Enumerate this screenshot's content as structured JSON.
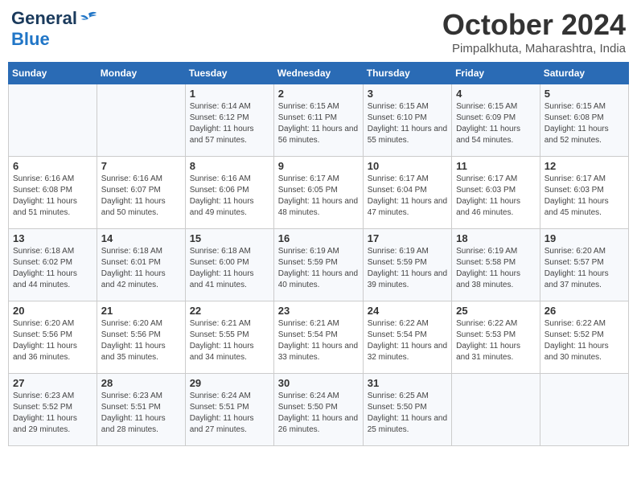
{
  "header": {
    "logo_line1": "General",
    "logo_line2": "Blue",
    "month": "October 2024",
    "location": "Pimpalkhuta, Maharashtra, India"
  },
  "weekdays": [
    "Sunday",
    "Monday",
    "Tuesday",
    "Wednesday",
    "Thursday",
    "Friday",
    "Saturday"
  ],
  "weeks": [
    [
      {
        "day": "",
        "sunrise": "",
        "sunset": "",
        "daylight": ""
      },
      {
        "day": "",
        "sunrise": "",
        "sunset": "",
        "daylight": ""
      },
      {
        "day": "1",
        "sunrise": "Sunrise: 6:14 AM",
        "sunset": "Sunset: 6:12 PM",
        "daylight": "Daylight: 11 hours and 57 minutes."
      },
      {
        "day": "2",
        "sunrise": "Sunrise: 6:15 AM",
        "sunset": "Sunset: 6:11 PM",
        "daylight": "Daylight: 11 hours and 56 minutes."
      },
      {
        "day": "3",
        "sunrise": "Sunrise: 6:15 AM",
        "sunset": "Sunset: 6:10 PM",
        "daylight": "Daylight: 11 hours and 55 minutes."
      },
      {
        "day": "4",
        "sunrise": "Sunrise: 6:15 AM",
        "sunset": "Sunset: 6:09 PM",
        "daylight": "Daylight: 11 hours and 54 minutes."
      },
      {
        "day": "5",
        "sunrise": "Sunrise: 6:15 AM",
        "sunset": "Sunset: 6:08 PM",
        "daylight": "Daylight: 11 hours and 52 minutes."
      }
    ],
    [
      {
        "day": "6",
        "sunrise": "Sunrise: 6:16 AM",
        "sunset": "Sunset: 6:08 PM",
        "daylight": "Daylight: 11 hours and 51 minutes."
      },
      {
        "day": "7",
        "sunrise": "Sunrise: 6:16 AM",
        "sunset": "Sunset: 6:07 PM",
        "daylight": "Daylight: 11 hours and 50 minutes."
      },
      {
        "day": "8",
        "sunrise": "Sunrise: 6:16 AM",
        "sunset": "Sunset: 6:06 PM",
        "daylight": "Daylight: 11 hours and 49 minutes."
      },
      {
        "day": "9",
        "sunrise": "Sunrise: 6:17 AM",
        "sunset": "Sunset: 6:05 PM",
        "daylight": "Daylight: 11 hours and 48 minutes."
      },
      {
        "day": "10",
        "sunrise": "Sunrise: 6:17 AM",
        "sunset": "Sunset: 6:04 PM",
        "daylight": "Daylight: 11 hours and 47 minutes."
      },
      {
        "day": "11",
        "sunrise": "Sunrise: 6:17 AM",
        "sunset": "Sunset: 6:03 PM",
        "daylight": "Daylight: 11 hours and 46 minutes."
      },
      {
        "day": "12",
        "sunrise": "Sunrise: 6:17 AM",
        "sunset": "Sunset: 6:03 PM",
        "daylight": "Daylight: 11 hours and 45 minutes."
      }
    ],
    [
      {
        "day": "13",
        "sunrise": "Sunrise: 6:18 AM",
        "sunset": "Sunset: 6:02 PM",
        "daylight": "Daylight: 11 hours and 44 minutes."
      },
      {
        "day": "14",
        "sunrise": "Sunrise: 6:18 AM",
        "sunset": "Sunset: 6:01 PM",
        "daylight": "Daylight: 11 hours and 42 minutes."
      },
      {
        "day": "15",
        "sunrise": "Sunrise: 6:18 AM",
        "sunset": "Sunset: 6:00 PM",
        "daylight": "Daylight: 11 hours and 41 minutes."
      },
      {
        "day": "16",
        "sunrise": "Sunrise: 6:19 AM",
        "sunset": "Sunset: 5:59 PM",
        "daylight": "Daylight: 11 hours and 40 minutes."
      },
      {
        "day": "17",
        "sunrise": "Sunrise: 6:19 AM",
        "sunset": "Sunset: 5:59 PM",
        "daylight": "Daylight: 11 hours and 39 minutes."
      },
      {
        "day": "18",
        "sunrise": "Sunrise: 6:19 AM",
        "sunset": "Sunset: 5:58 PM",
        "daylight": "Daylight: 11 hours and 38 minutes."
      },
      {
        "day": "19",
        "sunrise": "Sunrise: 6:20 AM",
        "sunset": "Sunset: 5:57 PM",
        "daylight": "Daylight: 11 hours and 37 minutes."
      }
    ],
    [
      {
        "day": "20",
        "sunrise": "Sunrise: 6:20 AM",
        "sunset": "Sunset: 5:56 PM",
        "daylight": "Daylight: 11 hours and 36 minutes."
      },
      {
        "day": "21",
        "sunrise": "Sunrise: 6:20 AM",
        "sunset": "Sunset: 5:56 PM",
        "daylight": "Daylight: 11 hours and 35 minutes."
      },
      {
        "day": "22",
        "sunrise": "Sunrise: 6:21 AM",
        "sunset": "Sunset: 5:55 PM",
        "daylight": "Daylight: 11 hours and 34 minutes."
      },
      {
        "day": "23",
        "sunrise": "Sunrise: 6:21 AM",
        "sunset": "Sunset: 5:54 PM",
        "daylight": "Daylight: 11 hours and 33 minutes."
      },
      {
        "day": "24",
        "sunrise": "Sunrise: 6:22 AM",
        "sunset": "Sunset: 5:54 PM",
        "daylight": "Daylight: 11 hours and 32 minutes."
      },
      {
        "day": "25",
        "sunrise": "Sunrise: 6:22 AM",
        "sunset": "Sunset: 5:53 PM",
        "daylight": "Daylight: 11 hours and 31 minutes."
      },
      {
        "day": "26",
        "sunrise": "Sunrise: 6:22 AM",
        "sunset": "Sunset: 5:52 PM",
        "daylight": "Daylight: 11 hours and 30 minutes."
      }
    ],
    [
      {
        "day": "27",
        "sunrise": "Sunrise: 6:23 AM",
        "sunset": "Sunset: 5:52 PM",
        "daylight": "Daylight: 11 hours and 29 minutes."
      },
      {
        "day": "28",
        "sunrise": "Sunrise: 6:23 AM",
        "sunset": "Sunset: 5:51 PM",
        "daylight": "Daylight: 11 hours and 28 minutes."
      },
      {
        "day": "29",
        "sunrise": "Sunrise: 6:24 AM",
        "sunset": "Sunset: 5:51 PM",
        "daylight": "Daylight: 11 hours and 27 minutes."
      },
      {
        "day": "30",
        "sunrise": "Sunrise: 6:24 AM",
        "sunset": "Sunset: 5:50 PM",
        "daylight": "Daylight: 11 hours and 26 minutes."
      },
      {
        "day": "31",
        "sunrise": "Sunrise: 6:25 AM",
        "sunset": "Sunset: 5:50 PM",
        "daylight": "Daylight: 11 hours and 25 minutes."
      },
      {
        "day": "",
        "sunrise": "",
        "sunset": "",
        "daylight": ""
      },
      {
        "day": "",
        "sunrise": "",
        "sunset": "",
        "daylight": ""
      }
    ]
  ]
}
